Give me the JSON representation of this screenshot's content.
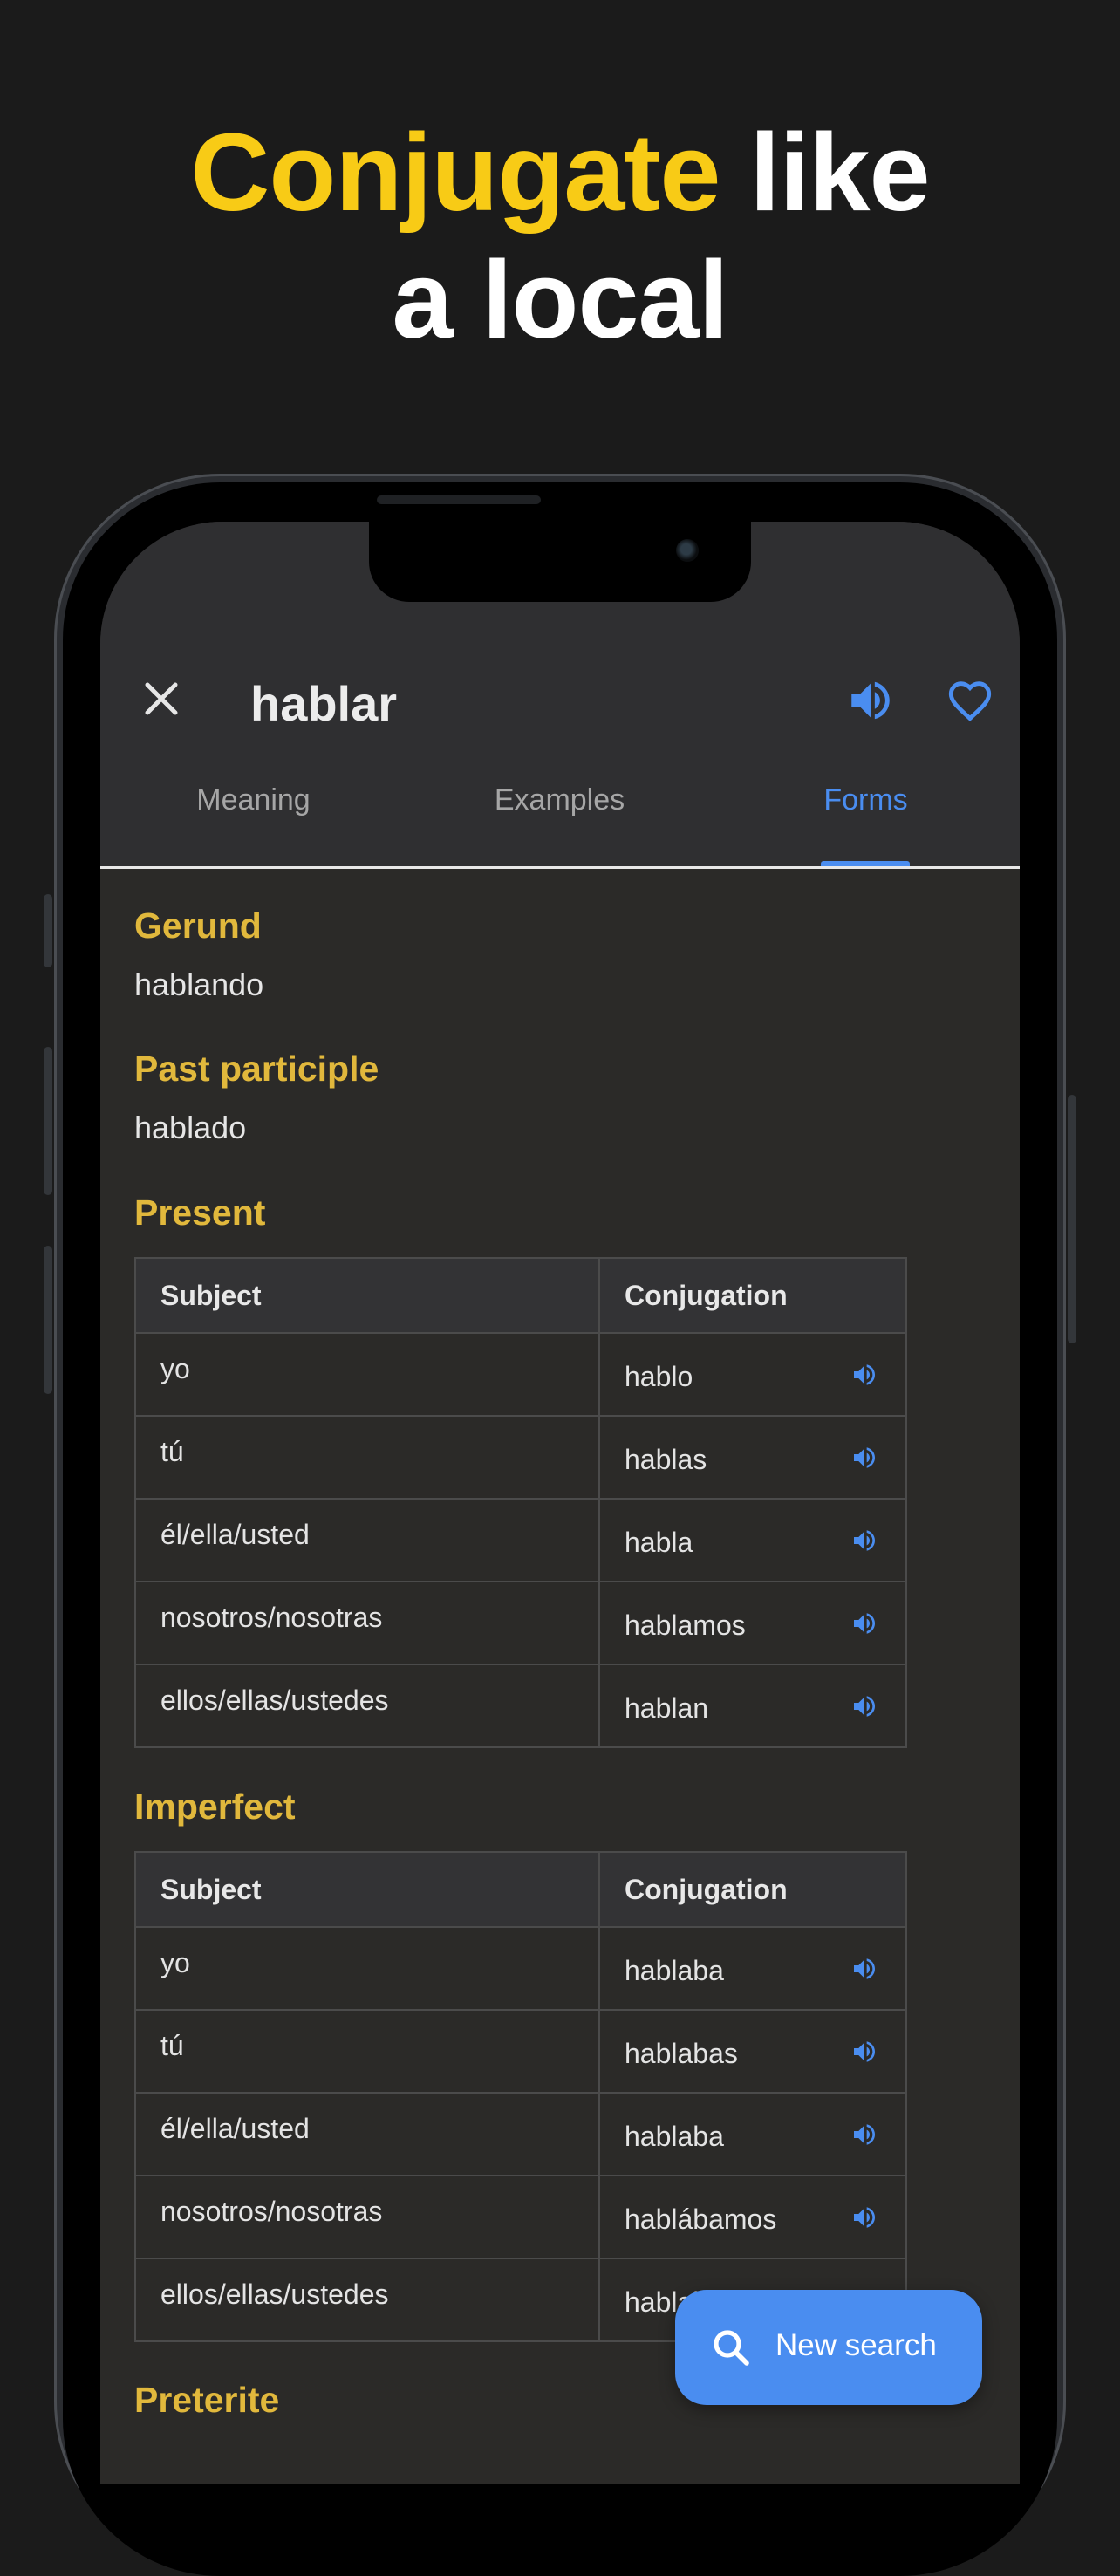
{
  "headline": {
    "part1": "Conjugate",
    "part2": " like",
    "part3": "a local"
  },
  "header": {
    "word": "hablar"
  },
  "tabs": [
    {
      "label": "Meaning",
      "active": false
    },
    {
      "label": "Examples",
      "active": false
    },
    {
      "label": "Forms",
      "active": true
    }
  ],
  "forms": {
    "gerund": {
      "title": "Gerund",
      "value": "hablando"
    },
    "past_participle": {
      "title": "Past participle",
      "value": "hablado"
    }
  },
  "tables": {
    "present": {
      "title": "Present",
      "headers": {
        "subject": "Subject",
        "conjugation": "Conjugation"
      },
      "rows": [
        {
          "subject": "yo",
          "conjugation": "hablo"
        },
        {
          "subject": "tú",
          "conjugation": "hablas"
        },
        {
          "subject": "él/ella/usted",
          "conjugation": "habla"
        },
        {
          "subject": "nosotros/nosotras",
          "conjugation": "hablamos"
        },
        {
          "subject": "ellos/ellas/ustedes",
          "conjugation": "hablan"
        }
      ]
    },
    "imperfect": {
      "title": "Imperfect",
      "headers": {
        "subject": "Subject",
        "conjugation": "Conjugation"
      },
      "rows": [
        {
          "subject": "yo",
          "conjugation": "hablaba"
        },
        {
          "subject": "tú",
          "conjugation": "hablabas"
        },
        {
          "subject": "él/ella/usted",
          "conjugation": "hablaba"
        },
        {
          "subject": "nosotros/nosotras",
          "conjugation": "hablábamos"
        },
        {
          "subject": "ellos/ellas/ustedes",
          "conjugation": "hablaban"
        }
      ]
    },
    "preterite": {
      "title": "Preterite"
    }
  },
  "fab": {
    "label": "New search"
  },
  "colors": {
    "accent_blue": "#4a8df0",
    "heading_gold": "#e1b83c",
    "headline_yellow": "#f8cb16",
    "background": "#1b1b1b"
  },
  "icons": {
    "close": "close-icon",
    "audio": "speaker-icon",
    "favorite": "heart-icon",
    "search": "search-icon"
  }
}
